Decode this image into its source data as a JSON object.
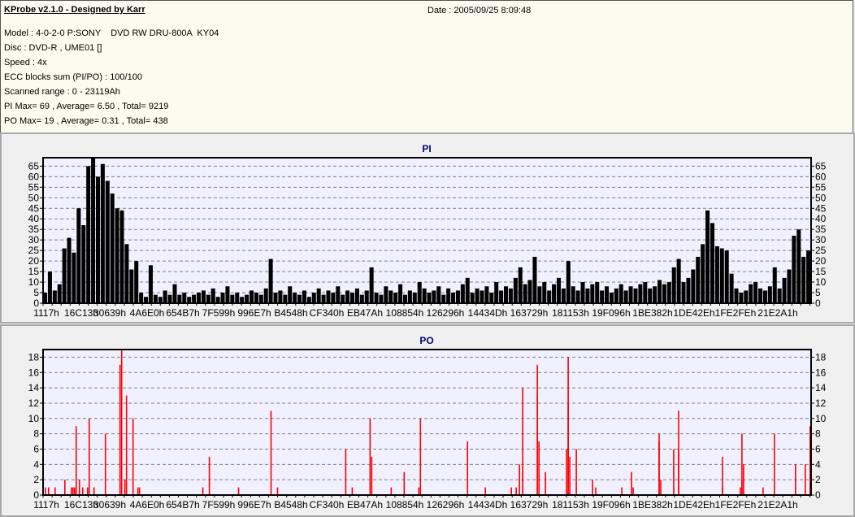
{
  "header": {
    "app_title": "KProbe v2.1.0 - Designed by Karr",
    "date": "Date : 2005/09/25 8:09:48",
    "lines": [
      "Model : 4-0-2-0 P:SONY    DVD RW DRU-800A  KY04",
      "Disc : DVD-R , UME01 []",
      "Speed : 4x",
      "ECC blocks sum (PI/PO) : 100/100",
      "Scanned range : 0 - 23119Ah",
      "PI Max= 69 , Average= 6.50 , Total= 9219",
      "PO Max= 19 , Average= 0.31 , Total= 438"
    ]
  },
  "colors": {
    "pi_bar": "#000000",
    "po_bar": "#ff0000",
    "plot_bg": "#f0f0ff",
    "title": "#000080"
  },
  "chart_data": [
    {
      "type": "bar",
      "title": "PI",
      "ylim": [
        0,
        69
      ],
      "yticks": [
        "0",
        "5",
        "10",
        "15",
        "20",
        "25",
        "30",
        "35",
        "40",
        "45",
        "50",
        "55",
        "60",
        "65"
      ],
      "xticks": [
        "1117h",
        "16C13h",
        "30639h",
        "4A6E0h",
        "654B7h",
        "7F599h",
        "996E7h",
        "B4548h",
        "CF340h",
        "EB47Ah",
        "108854h",
        "126296h",
        "14434Dh",
        "163729h",
        "181153h",
        "19F096h",
        "1BE382h",
        "1DE42Eh",
        "1FE2FEh",
        "21E2A1h"
      ],
      "grid": true,
      "values": [
        5,
        15,
        6,
        9,
        26,
        31,
        24,
        45,
        37,
        65,
        69,
        60,
        66,
        58,
        52,
        45,
        44,
        28,
        16,
        20,
        5,
        3,
        18,
        4,
        3,
        6,
        4,
        9,
        4,
        5,
        3,
        4,
        5,
        6,
        4,
        7,
        3,
        5,
        8,
        4,
        5,
        3,
        4,
        6,
        5,
        4,
        7,
        21,
        5,
        6,
        4,
        8,
        5,
        4,
        6,
        3,
        5,
        7,
        4,
        6,
        5,
        8,
        4,
        6,
        5,
        7,
        4,
        6,
        17,
        5,
        4,
        8,
        6,
        5,
        9,
        4,
        6,
        5,
        10,
        7,
        5,
        6,
        8,
        4,
        7,
        5,
        6,
        9,
        12,
        5,
        7,
        6,
        8,
        5,
        10,
        6,
        8,
        7,
        12,
        17,
        9,
        11,
        22,
        8,
        10,
        6,
        9,
        12,
        7,
        20,
        8,
        6,
        10,
        7,
        9,
        10,
        6,
        8,
        5,
        7,
        9,
        6,
        8,
        7,
        9,
        10,
        7,
        8,
        11,
        9,
        10,
        17,
        21,
        10,
        12,
        16,
        22,
        28,
        44,
        38,
        27,
        26,
        25,
        14,
        7,
        5,
        6,
        9,
        10,
        7,
        6,
        8,
        17,
        7,
        12,
        16,
        32,
        35,
        22,
        25
      ]
    },
    {
      "type": "bar",
      "title": "PO",
      "ylim": [
        0,
        19
      ],
      "yticks": [
        "0",
        "2",
        "4",
        "6",
        "8",
        "10",
        "12",
        "14",
        "16",
        "18"
      ],
      "xticks": [
        "1117h",
        "16C13h",
        "30639h",
        "4A6E0h",
        "654B7h",
        "7F599h",
        "996E7h",
        "B4548h",
        "CF340h",
        "EB47Ah",
        "108854h",
        "126296h",
        "14434Dh",
        "163729h",
        "181153h",
        "19F096h",
        "1BE382h",
        "1DE42Eh",
        "1FE2FEh",
        "21E2A1h"
      ],
      "grid": true,
      "samples": 473,
      "spikes": [
        [
          1,
          1
        ],
        [
          3,
          1
        ],
        [
          7,
          1
        ],
        [
          13,
          2
        ],
        [
          17,
          1
        ],
        [
          18,
          1
        ],
        [
          19,
          1
        ],
        [
          19,
          1
        ],
        [
          20,
          9
        ],
        [
          22,
          2
        ],
        [
          24,
          1
        ],
        [
          27,
          1
        ],
        [
          28,
          10
        ],
        [
          31,
          1
        ],
        [
          38,
          8
        ],
        [
          47,
          17
        ],
        [
          48,
          19
        ],
        [
          50,
          2
        ],
        [
          51,
          13
        ],
        [
          55,
          10
        ],
        [
          58,
          1
        ],
        [
          59,
          1
        ],
        [
          98,
          1
        ],
        [
          102,
          5
        ],
        [
          120,
          1
        ],
        [
          140,
          11
        ],
        [
          144,
          1
        ],
        [
          186,
          6
        ],
        [
          190,
          1
        ],
        [
          201,
          10
        ],
        [
          202,
          5
        ],
        [
          214,
          1
        ],
        [
          222,
          3
        ],
        [
          231,
          1
        ],
        [
          232,
          10
        ],
        [
          261,
          7
        ],
        [
          272,
          1
        ],
        [
          288,
          1
        ],
        [
          291,
          1
        ],
        [
          293,
          4
        ],
        [
          295,
          14
        ],
        [
          295,
          3
        ],
        [
          304,
          17
        ],
        [
          304,
          13
        ],
        [
          305,
          7
        ],
        [
          309,
          3
        ],
        [
          322,
          6
        ],
        [
          323,
          18
        ],
        [
          323,
          12
        ],
        [
          324,
          5
        ],
        [
          328,
          6
        ],
        [
          338,
          2
        ],
        [
          340,
          1
        ],
        [
          356,
          1
        ],
        [
          362,
          3
        ],
        [
          363,
          1
        ],
        [
          379,
          7
        ],
        [
          379,
          8
        ],
        [
          380,
          2
        ],
        [
          388,
          6
        ],
        [
          391,
          11
        ],
        [
          391,
          6
        ],
        [
          418,
          5
        ],
        [
          418,
          1
        ],
        [
          429,
          1
        ],
        [
          430,
          2
        ],
        [
          430,
          8
        ],
        [
          431,
          4
        ],
        [
          443,
          1
        ],
        [
          450,
          8
        ],
        [
          463,
          4
        ],
        [
          469,
          4
        ],
        [
          472,
          9
        ]
      ]
    }
  ]
}
